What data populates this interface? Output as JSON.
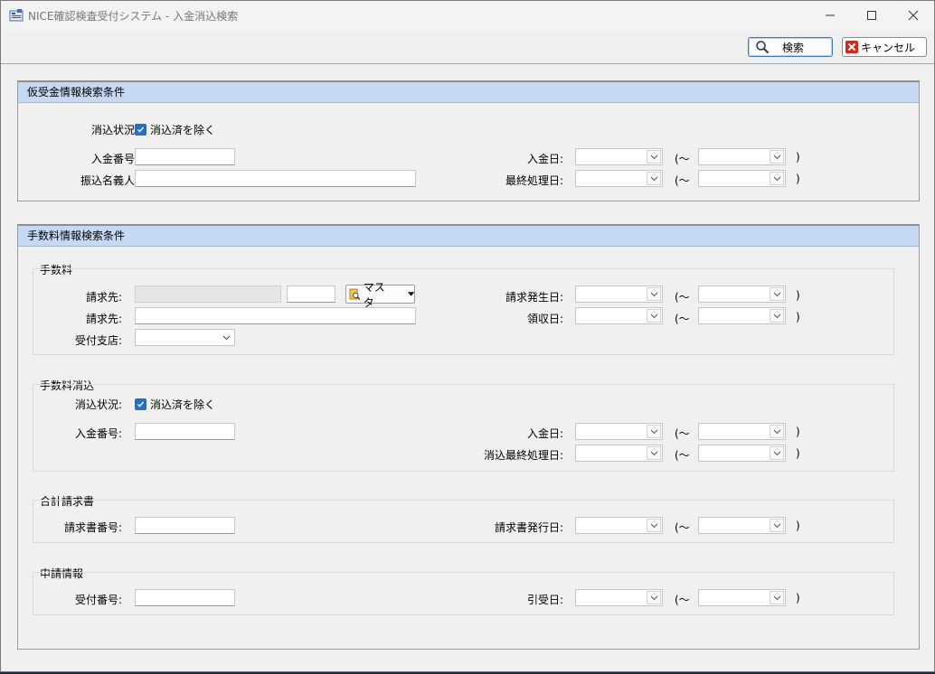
{
  "window": {
    "title": "NICE確認検査受付システム - 入金消込検索",
    "minimize_icon": "minimize-icon",
    "maximize_icon": "maximize-icon",
    "close_icon": "close-icon"
  },
  "toolbar": {
    "search_label": "検索",
    "cancel_label": "キャンセル"
  },
  "advance": {
    "header": "仮受金情報検索条件",
    "status_label": "消込状況:",
    "status_checkbox": "消込済を除く",
    "deposit_no_label": "入金番号:",
    "payer_name_label": "振込名義人:",
    "deposit_date_label": "入金日:",
    "last_processed_label": "最終処理日:",
    "range_open": "(～",
    "range_close": ")"
  },
  "fee": {
    "header": "手数料情報検索条件",
    "fee_group": {
      "title": "手数料",
      "billing_label": "請求先:",
      "billing_label2": "請求先:",
      "master_button": "マスタ",
      "branch_label": "受付支店:",
      "issue_date_label": "請求発生日:",
      "receipt_date_label": "領収日:"
    },
    "clear_group": {
      "title": "手数料消込",
      "status_label": "消込状況:",
      "status_checkbox": "消込済を除く",
      "deposit_no_label": "入金番号:",
      "deposit_date_label": "入金日:",
      "last_processed_label": "消込最終処理日:"
    },
    "invoice_group": {
      "title": "合計請求書",
      "invoice_no_label": "請求書番号:",
      "invoice_date_label": "請求書発行日:"
    },
    "application_group": {
      "title": "申請情報",
      "receipt_no_label": "受付番号:",
      "handover_date_label": "引受日:"
    },
    "range_open": "(～",
    "range_close": ")"
  }
}
